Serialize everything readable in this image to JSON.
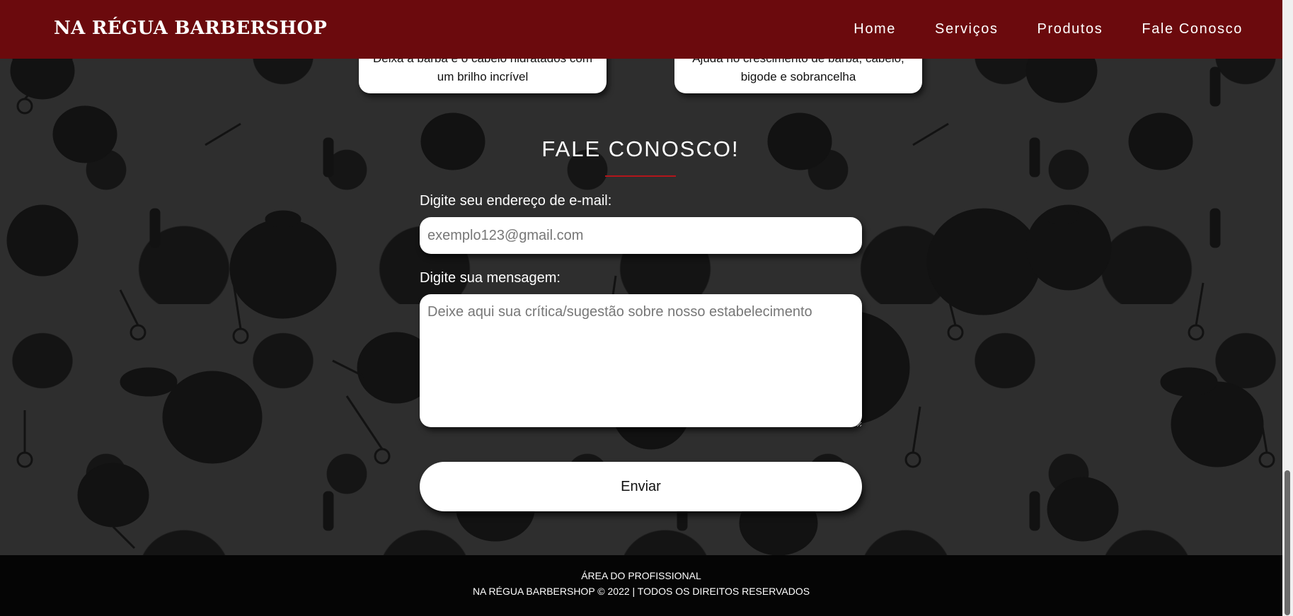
{
  "header": {
    "brand": "NA RÉGUA BARBERSHOP",
    "nav": [
      {
        "label": "Home"
      },
      {
        "label": "Serviços"
      },
      {
        "label": "Produtos"
      },
      {
        "label": "Fale Conosco"
      }
    ],
    "color": "#6b0a0d"
  },
  "products": [
    {
      "description": "Deixa a barba e o cabelo hidratados com um brilho incrível"
    },
    {
      "description": "Ajuda no crescimento de barba, cabelo, bigode e sobrancelha"
    }
  ],
  "contact": {
    "title": "FALE CONOSCO!",
    "email_label": "Digite seu endereço de e-mail:",
    "email_placeholder": "exemplo123@gmail.com",
    "email_value": "",
    "message_label": "Digite sua mensagem:",
    "message_placeholder": "Deixe aqui sua crítica/sugestão sobre nosso estabelecimento",
    "message_value": "",
    "submit_label": "Enviar",
    "accent": "#b3151b"
  },
  "footer": {
    "pro_link": "ÁREA DO PROFISSIONAL",
    "copyright": "NA RÉGUA BARBERSHOP © 2022 | TODOS OS DIREITOS RESERVADOS"
  }
}
